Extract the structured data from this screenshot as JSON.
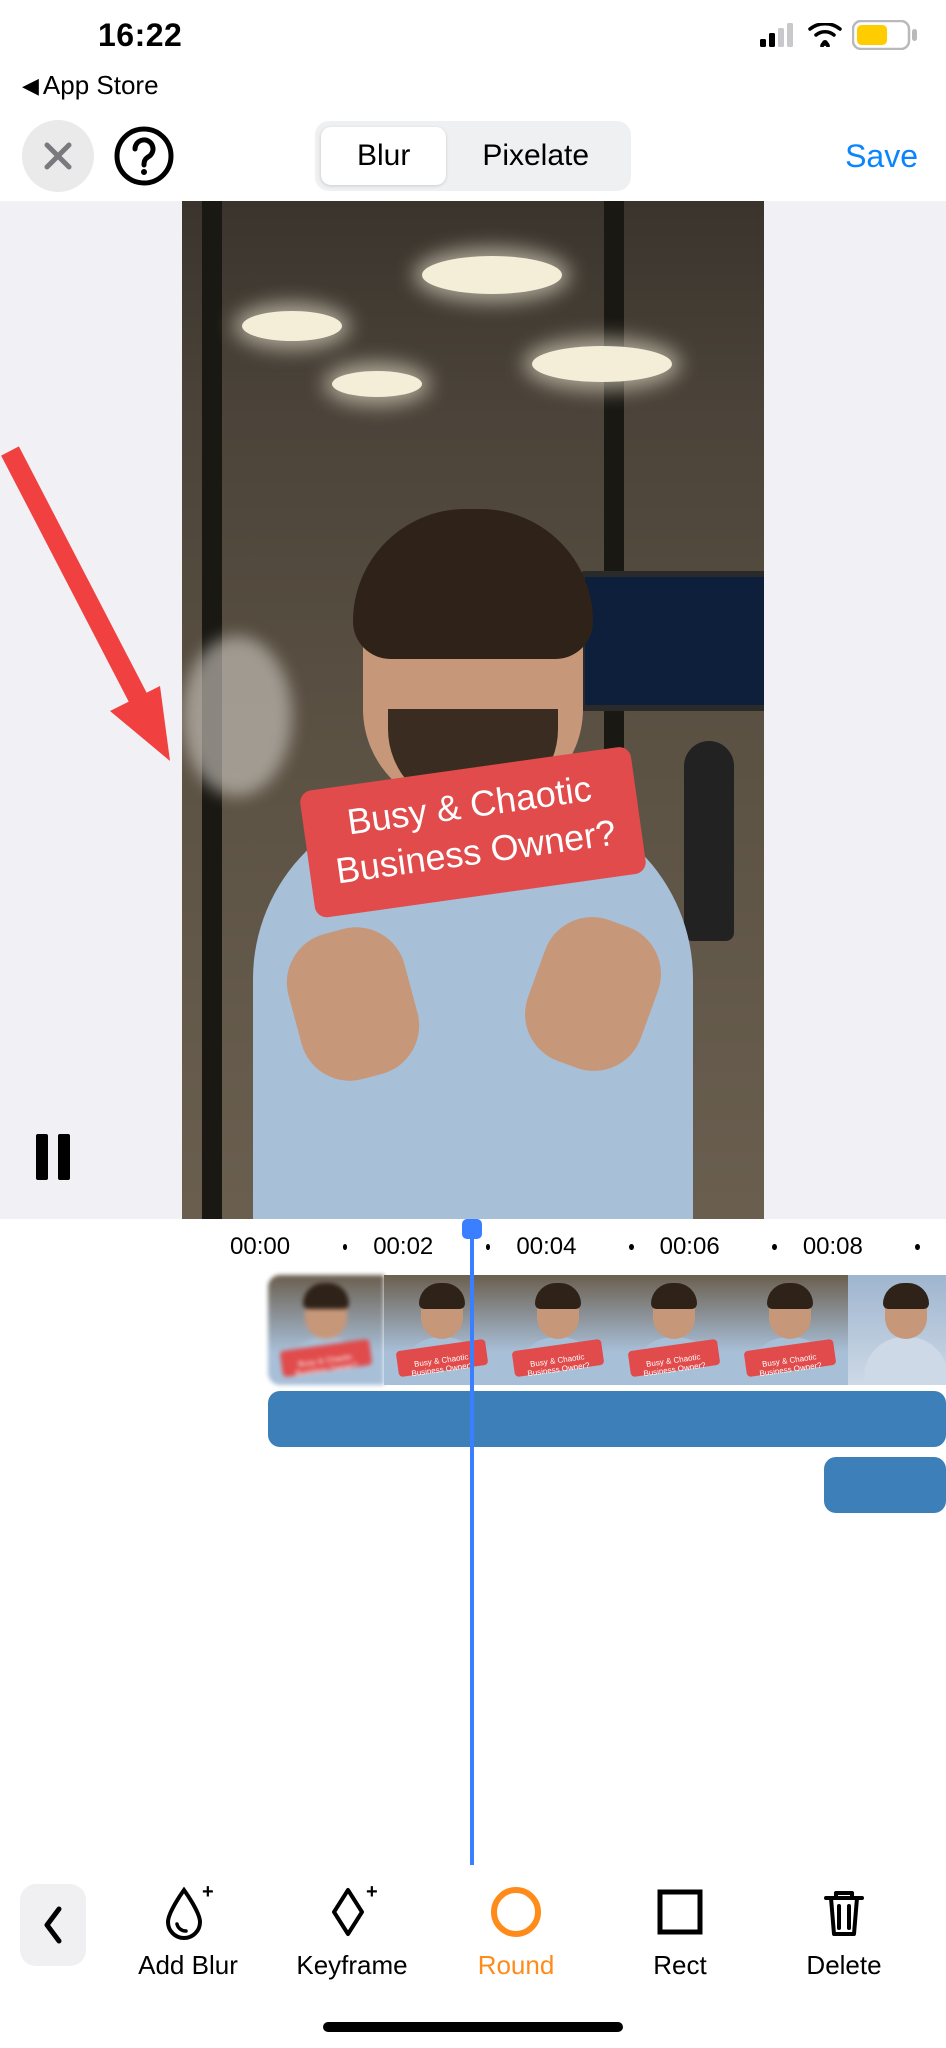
{
  "status_bar": {
    "time": "16:22",
    "back_app": "App Store"
  },
  "nav": {
    "segment": {
      "blur": "Blur",
      "pixelate": "Pixelate"
    },
    "save": "Save"
  },
  "video_overlay": {
    "line1": "Busy & Chaotic",
    "line2": "Business Owner?"
  },
  "timeline": {
    "marks": [
      "00:00",
      "00:02",
      "00:04",
      "00:06",
      "00:08"
    ]
  },
  "toolbar": {
    "add_blur": "Add Blur",
    "keyframe": "Keyframe",
    "round": "Round",
    "rect": "Rect",
    "delete": "Delete"
  }
}
